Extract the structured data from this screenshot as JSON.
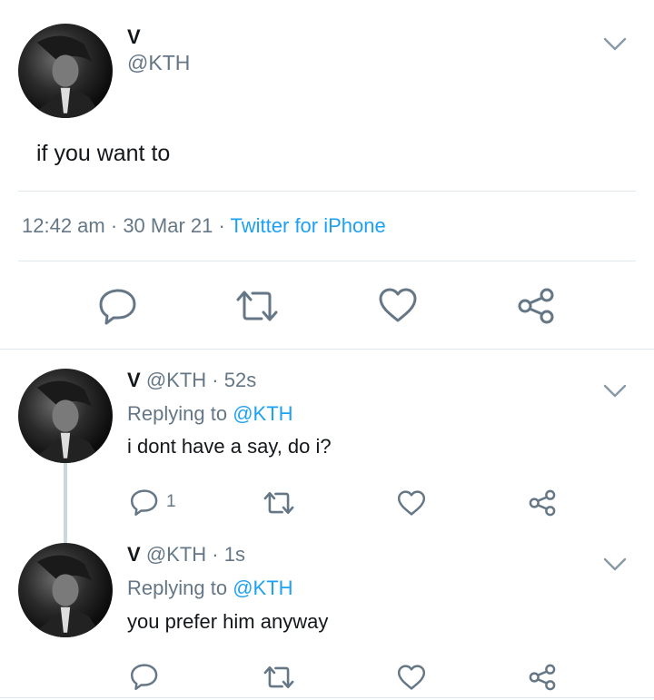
{
  "main_tweet": {
    "display_name": "V",
    "handle": "@KTH",
    "text": "if you want to",
    "time": "12:42 am",
    "sep1": "·",
    "date": "30 Mar 21",
    "sep2": "·",
    "source": "Twitter for iPhone"
  },
  "replies": [
    {
      "display_name": "V",
      "handle": "@KTH",
      "dot": "·",
      "age": "52s",
      "replying_label": "Replying to",
      "replying_to": "@KTH",
      "text": "i dont have a say, do i?",
      "reply_count": "1"
    },
    {
      "display_name": "V",
      "handle": "@KTH",
      "dot": "·",
      "age": "1s",
      "replying_label": "Replying to",
      "replying_to": "@KTH",
      "text": "you prefer him anyway",
      "reply_count": ""
    }
  ],
  "icons": {
    "reply": "reply-icon",
    "retweet": "retweet-icon",
    "like": "heart-icon",
    "share": "share-icon",
    "more": "chevron-down-icon"
  },
  "colors": {
    "text": "#14171a",
    "secondary": "#657786",
    "link": "#1da1f2",
    "divider": "#e1e8ed"
  }
}
